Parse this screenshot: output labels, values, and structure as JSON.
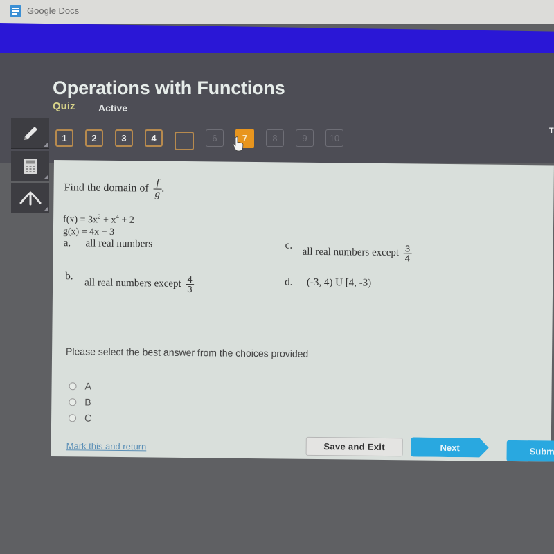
{
  "browser": {
    "tab_title": "Google Docs",
    "tab_icon": "google-docs-icon"
  },
  "colors": {
    "banner": "#2a17d6",
    "header_bg": "#4d4d55",
    "quiz_label": "#d8d48a",
    "nav_border": "#b78a4e",
    "current_question": "#e8951e",
    "primary_button": "#29a8e0",
    "link": "#5b8fb6",
    "panel_bg": "#d9dfdb"
  },
  "header": {
    "title": "Operations with Functions",
    "type_label": "Quiz",
    "status": "Active",
    "right_truncated_text": "T"
  },
  "question_nav": {
    "items": [
      {
        "label": "1",
        "state": "answered"
      },
      {
        "label": "2",
        "state": "answered"
      },
      {
        "label": "3",
        "state": "answered"
      },
      {
        "label": "4",
        "state": "answered"
      },
      {
        "label": "",
        "state": "answered-blank"
      },
      {
        "label": "6",
        "state": "unvisited"
      },
      {
        "label": "7",
        "state": "current"
      },
      {
        "label": "8",
        "state": "unvisited"
      },
      {
        "label": "9",
        "state": "unvisited"
      },
      {
        "label": "10",
        "state": "unvisited"
      }
    ],
    "current": 7
  },
  "tools": [
    {
      "name": "pencil-icon"
    },
    {
      "name": "calculator-icon"
    },
    {
      "name": "arrow-up-icon"
    }
  ],
  "question": {
    "prompt": "Find the domain of",
    "fraction_num": "f",
    "fraction_den": "g",
    "prompt_end": ".",
    "f_def": {
      "lhs": "f(x) = 3x",
      "exp1": "2",
      "mid": " + x",
      "exp2": "4",
      "rhs": " + 2"
    },
    "g_def": "g(x) = 4x − 3",
    "choices": [
      {
        "letter": "a.",
        "text": "all real numbers"
      },
      {
        "letter": "b.",
        "text": "all real numbers except",
        "num": "4",
        "den": "3"
      },
      {
        "letter": "c.",
        "text": "all real numbers except",
        "num": "3",
        "den": "4"
      },
      {
        "letter": "d.",
        "text": "(-3, 4) U [4, -3)"
      }
    ]
  },
  "answer": {
    "instruction": "Please select the best answer from the choices provided",
    "options": [
      {
        "label": "A",
        "selected": false
      },
      {
        "label": "B",
        "selected": false
      },
      {
        "label": "C",
        "selected": false
      }
    ]
  },
  "footer": {
    "mark_link": "Mark this and return",
    "save_exit": "Save and Exit",
    "next": "Next",
    "submit": "Submit"
  }
}
